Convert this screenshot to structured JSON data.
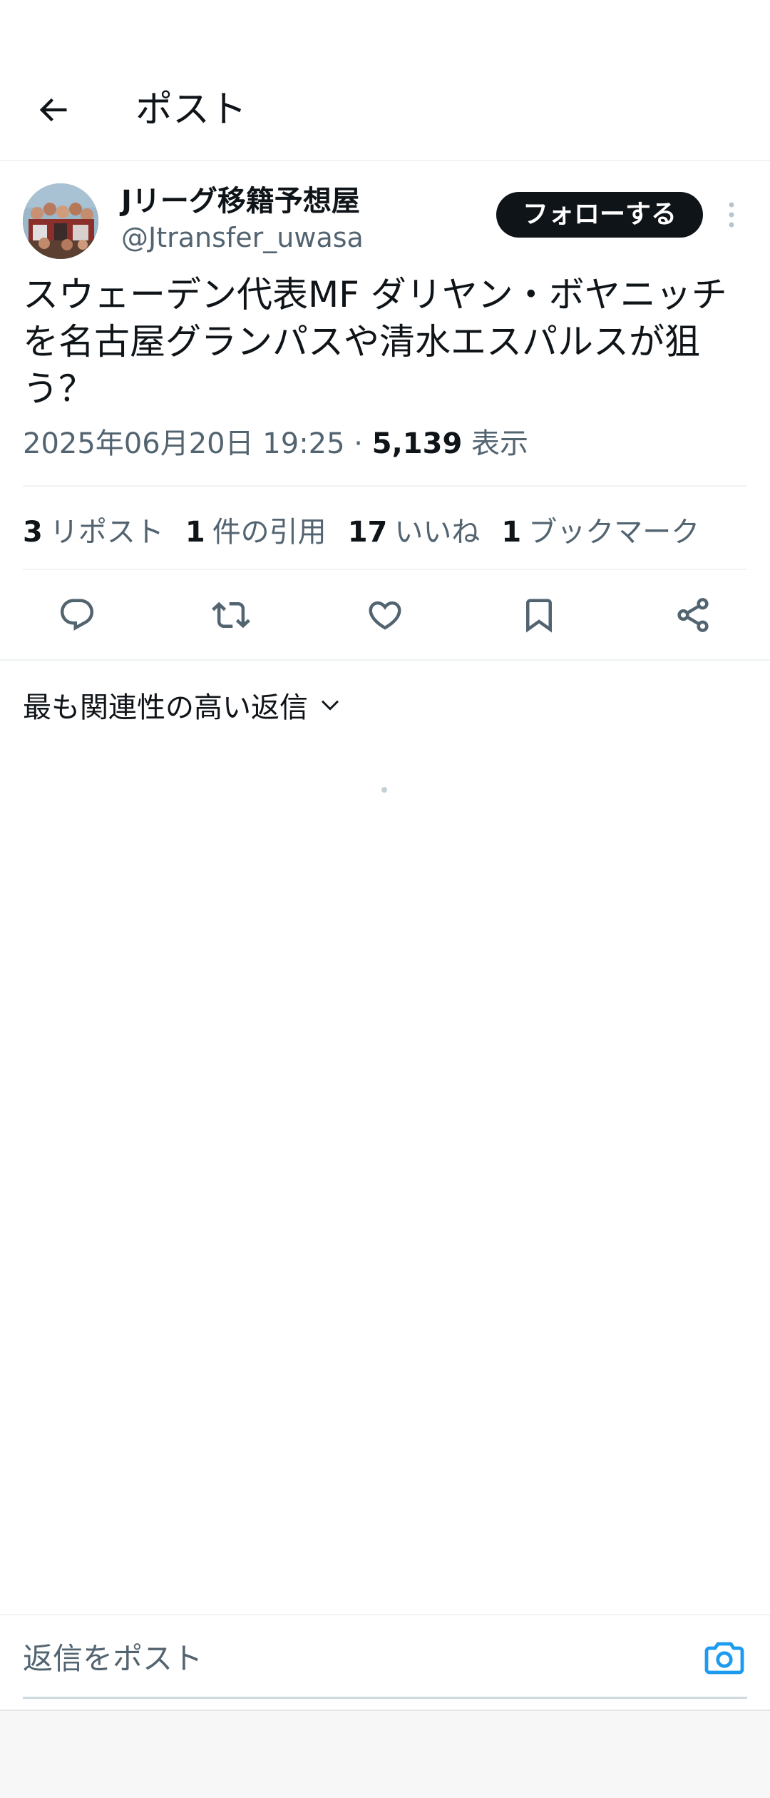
{
  "header": {
    "title": "ポスト",
    "back_icon": "arrow-left-icon"
  },
  "author": {
    "display_name": "Jリーグ移籍予想屋",
    "handle": "@Jtransfer_uwasa",
    "follow_label": "フォローする"
  },
  "post": {
    "text": "スウェーデン代表MF ダリヤン・ボヤニッチを名古屋グランパスや清水エスパルスが狙う？",
    "timestamp": "2025年06月20日 19:25",
    "separator": " · ",
    "views_count": "5,139",
    "views_label": "表示"
  },
  "stats": [
    {
      "count": "3",
      "label": "リポスト"
    },
    {
      "count": "1",
      "label": "件の引用"
    },
    {
      "count": "17",
      "label": "いいね"
    },
    {
      "count": "1",
      "label": "ブックマーク"
    }
  ],
  "actions": [
    "reply-icon",
    "repost-icon",
    "like-icon",
    "bookmark-icon",
    "share-icon"
  ],
  "replies": {
    "sort_label": "最も関連性の高い返信"
  },
  "composer": {
    "placeholder": "返信をポスト"
  },
  "colors": {
    "text": "#0f1419",
    "secondary": "#536471",
    "accent": "#1d9bf0",
    "follow_bg": "#0f1419"
  }
}
